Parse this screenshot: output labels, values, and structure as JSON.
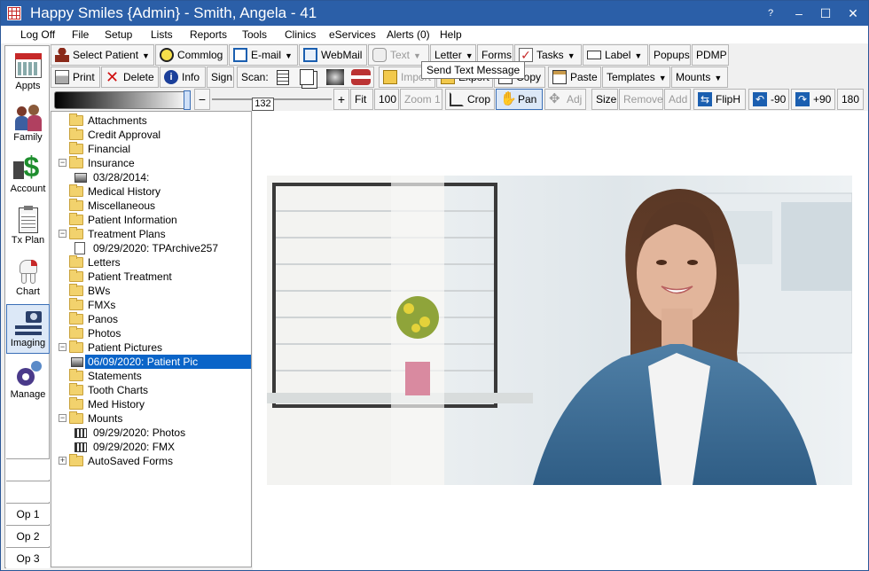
{
  "title": "Happy Smiles {Admin} - Smith, Angela - 41",
  "window_controls": {
    "help": "?",
    "minimize": "–",
    "maximize": "☐",
    "close": "✕"
  },
  "menu": [
    "Log Off",
    "File",
    "Setup",
    "Lists",
    "Reports",
    "Tools",
    "Clinics",
    "eServices",
    "Alerts (0)",
    "Help"
  ],
  "modules": [
    "Appts",
    "Family",
    "Account",
    "Tx Plan",
    "Chart",
    "Imaging",
    "Manage"
  ],
  "ops": [
    "Op 1",
    "Op 2",
    "Op 3"
  ],
  "toolbar1": {
    "select_patient": "Select Patient",
    "commlog": "Commlog",
    "email": "E-mail",
    "webmail": "WebMail",
    "text": "Text",
    "letter": "Letter",
    "forms": "Forms",
    "tasks": "Tasks",
    "label": "Label",
    "popups": "Popups",
    "pdmp": "PDMP"
  },
  "tooltip": "Send Text Message",
  "toolbar2": {
    "print": "Print",
    "delete": "Delete",
    "info": "Info",
    "sign": "Sign",
    "scan": "Scan:",
    "import": "Import",
    "export": "Export",
    "copy": "Copy",
    "paste": "Paste",
    "templates": "Templates",
    "mounts": "Mounts"
  },
  "toolbar3": {
    "minus": "−",
    "value": "132",
    "plus": "+",
    "fit": "Fit",
    "zoom100": "100",
    "zoom1": "Zoom 1",
    "crop": "Crop",
    "pan": "Pan",
    "adj": "Adj",
    "size": "Size",
    "remove": "Remove",
    "add": "Add",
    "fliph": "FlipH",
    "rot_left": "-90",
    "rot_right": "+90",
    "rot180": "180"
  },
  "tree": [
    {
      "label": "Attachments",
      "type": "folder",
      "level": 0
    },
    {
      "label": "Credit Approval",
      "type": "folder",
      "level": 0
    },
    {
      "label": "Financial",
      "type": "folder",
      "level": 0
    },
    {
      "label": "Insurance",
      "type": "folder",
      "level": 0,
      "expander": "−"
    },
    {
      "label": "03/28/2014:",
      "type": "image",
      "level": 1
    },
    {
      "label": "Medical History",
      "type": "folder",
      "level": 0
    },
    {
      "label": "Miscellaneous",
      "type": "folder",
      "level": 0
    },
    {
      "label": "Patient Information",
      "type": "folder",
      "level": 0
    },
    {
      "label": "Treatment Plans",
      "type": "folder",
      "level": 0,
      "expander": "−"
    },
    {
      "label": "09/29/2020: TPArchive257",
      "type": "doc",
      "level": 1
    },
    {
      "label": "Letters",
      "type": "folder",
      "level": 0
    },
    {
      "label": "Patient Treatment",
      "type": "folder",
      "level": 0
    },
    {
      "label": "BWs",
      "type": "folder",
      "level": 0
    },
    {
      "label": "FMXs",
      "type": "folder",
      "level": 0
    },
    {
      "label": "Panos",
      "type": "folder",
      "level": 0
    },
    {
      "label": "Photos",
      "type": "folder",
      "level": 0
    },
    {
      "label": "Patient Pictures",
      "type": "folder",
      "level": 0,
      "expander": "−"
    },
    {
      "label": "06/09/2020: Patient Pic",
      "type": "image",
      "level": 1,
      "selected": true
    },
    {
      "label": "Statements",
      "type": "folder",
      "level": 0
    },
    {
      "label": "Tooth Charts",
      "type": "folder",
      "level": 0
    },
    {
      "label": "Med History",
      "type": "folder",
      "level": 0
    },
    {
      "label": "Mounts",
      "type": "folder",
      "level": 0,
      "expander": "−"
    },
    {
      "label": "09/29/2020: Photos",
      "type": "mount",
      "level": 1
    },
    {
      "label": "09/29/2020: FMX",
      "type": "mount",
      "level": 1
    },
    {
      "label": "AutoSaved Forms",
      "type": "folder",
      "level": 0,
      "expander": "+"
    }
  ],
  "colors": {
    "titlebar": "#2b5fa8",
    "selection": "#0a64c8",
    "folder": "#f2d26d"
  }
}
